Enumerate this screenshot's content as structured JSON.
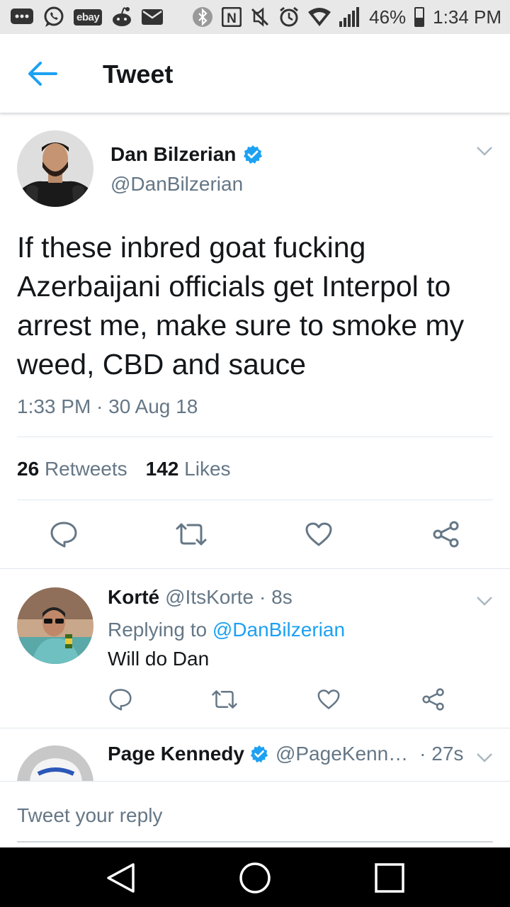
{
  "status_bar": {
    "ebay_label": "ebay",
    "nfc_label": "N",
    "battery_percent": "46%",
    "battery_level": 0.46,
    "time": "1:34 PM",
    "icons": [
      "chat-icon",
      "whatsapp-icon",
      "ebay-icon",
      "reddit-icon",
      "mail-icon",
      "bluetooth-icon",
      "nfc-icon",
      "mute-icon",
      "alarm-icon",
      "wifi-icon",
      "signal-icon",
      "battery-icon"
    ]
  },
  "header": {
    "title": "Tweet",
    "back_icon": "arrow-left-icon"
  },
  "tweet": {
    "author_name": "Dan Bilzerian",
    "author_handle": "@DanBilzerian",
    "verified": true,
    "text": "If these inbred goat fucking Azerbaijani officials get Interpol to arrest me, make sure to smoke my weed, CBD and sauce",
    "timestamp": "1:33 PM · 30 Aug 18",
    "retweet_count": "26",
    "retweet_label": "Retweets",
    "like_count": "142",
    "like_label": "Likes"
  },
  "replies": [
    {
      "name": "Korté",
      "handle": "@ItsKorte",
      "age": "· 8s",
      "replying_prefix": "Replying to",
      "replying_to": "@DanBilzerian",
      "text": "Will do Dan"
    },
    {
      "name": "Page Kennedy",
      "handle": "@PageKenn…",
      "age": "· 27s",
      "verified": true
    }
  ],
  "reply_box": {
    "placeholder": "Tweet your reply"
  },
  "colors": {
    "accent": "#1da1f2",
    "muted": "#657786",
    "text": "#14171a",
    "status_bar": "#e8e8e8",
    "nav_bar": "#000000"
  }
}
